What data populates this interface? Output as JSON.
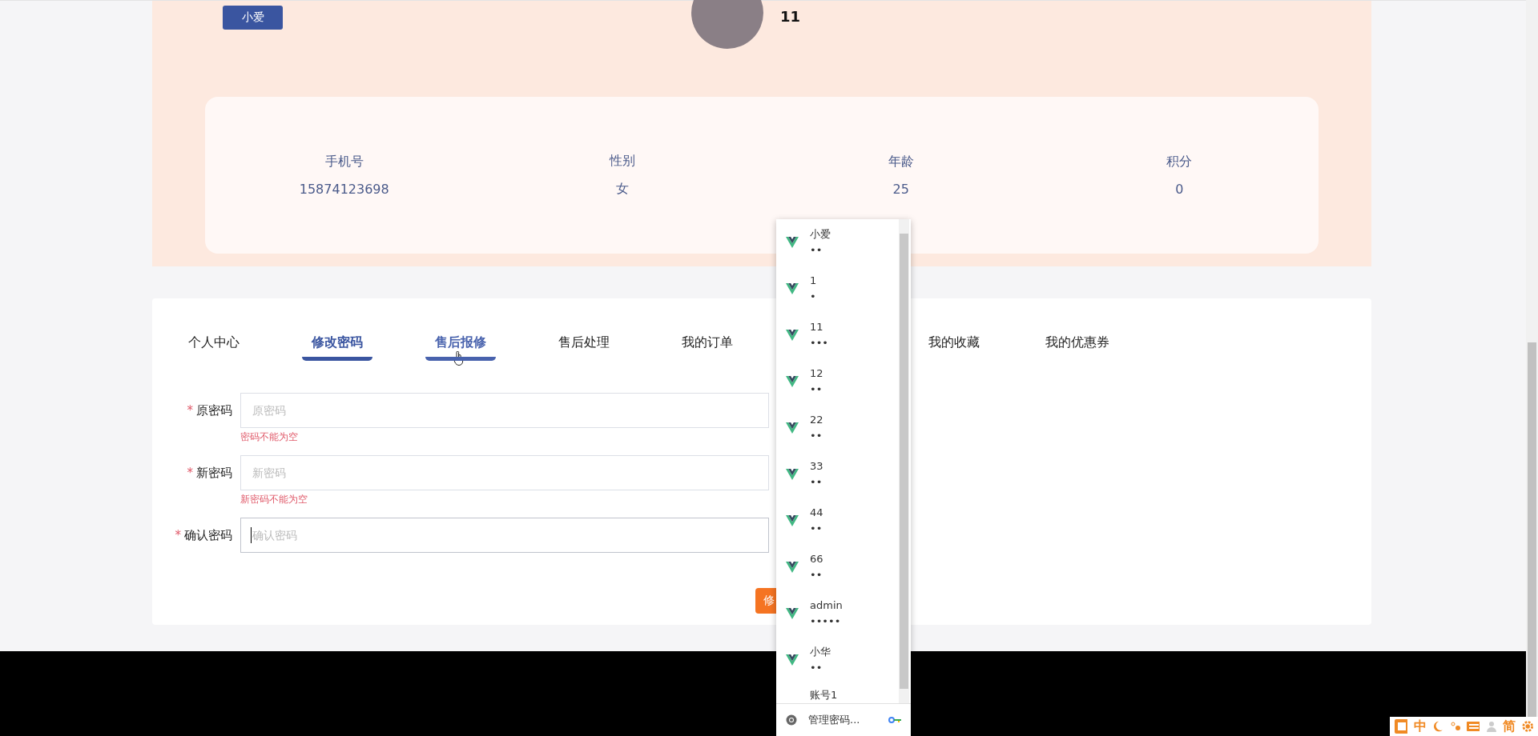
{
  "profile": {
    "name_button": "小爱",
    "username": "11",
    "stats": [
      {
        "label": "手机号",
        "value": "15874123698"
      },
      {
        "label": "性别",
        "value": "女"
      },
      {
        "label": "年龄",
        "value": "25"
      },
      {
        "label": "积分",
        "value": "0"
      }
    ]
  },
  "tabs": [
    {
      "label": "个人中心",
      "selected": false,
      "hovered": false
    },
    {
      "label": "修改密码",
      "selected": true,
      "hovered": false
    },
    {
      "label": "售后报修",
      "selected": false,
      "hovered": true
    },
    {
      "label": "售后处理",
      "selected": false,
      "hovered": false
    },
    {
      "label": "我的订单",
      "selected": false,
      "hovered": false
    },
    {
      "label": "我的收藏",
      "selected": false,
      "hovered": false
    },
    {
      "label": "我的优惠券",
      "selected": false,
      "hovered": false
    }
  ],
  "form": {
    "fields": [
      {
        "label": "原密码",
        "required_mark": "*",
        "placeholder": "原密码",
        "error": "密码不能为空",
        "focused": false
      },
      {
        "label": "新密码",
        "required_mark": "*",
        "placeholder": "新密码",
        "error": "新密码不能为空",
        "focused": false
      },
      {
        "label": "确认密码",
        "required_mark": "*",
        "placeholder": "确认密码",
        "focused": true
      }
    ],
    "submit": "修"
  },
  "password_dropdown": {
    "items": [
      {
        "user": "小爱",
        "password": "••"
      },
      {
        "user": "1",
        "password": "•"
      },
      {
        "user": "11",
        "password": "•••"
      },
      {
        "user": "12",
        "password": "••"
      },
      {
        "user": "22",
        "password": "••"
      },
      {
        "user": "33",
        "password": "••"
      },
      {
        "user": "44",
        "password": "••"
      },
      {
        "user": "66",
        "password": "••"
      },
      {
        "user": "admin",
        "password": "•••••"
      },
      {
        "user": "小华",
        "password": "••"
      },
      {
        "user": "账号1"
      }
    ],
    "manage": "管理密码..."
  },
  "ime_toolbar": {
    "items": [
      "中",
      "简"
    ]
  }
}
